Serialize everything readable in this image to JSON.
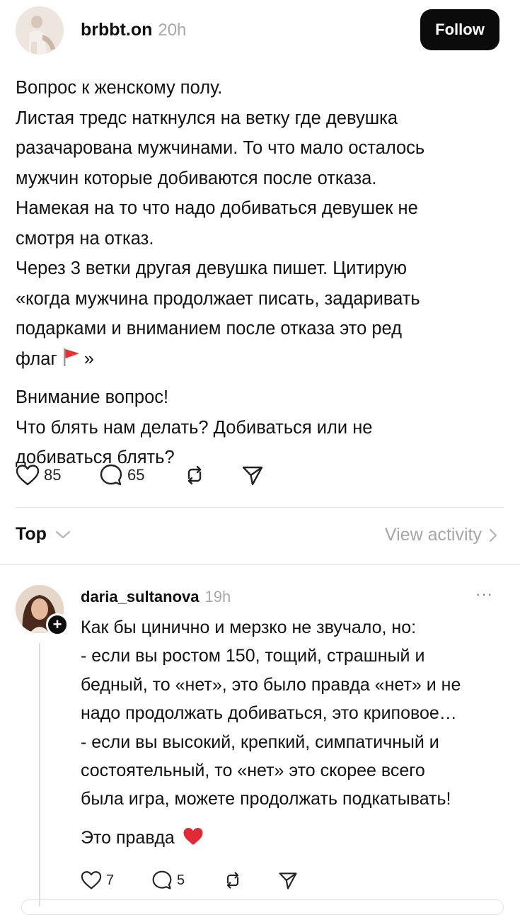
{
  "post": {
    "username": "brbbt.on",
    "time": "20h",
    "follow_label": "Follow",
    "paragraph1_lines": [
      "Вопрос к женскому полу.",
      "Листая тредс наткнулся на ветку где девушка",
      "разачарована мужчинами. То что мало осталось",
      "мужчин которые добиваются после отказа.",
      "Намекая на то что надо добиваться девушек не",
      "смотря на отказ.",
      "Через 3 ветки другая девушка пишет. Цитирую",
      "«когда мужчина продолжает писать, задаривать",
      "подарками и вниманием после отказа это ред"
    ],
    "flag_line_before": "флаг",
    "flag_line_after": "»",
    "paragraph2_lines": [
      "Внимание вопрос!",
      "Что блять нам делать? Добиваться или не",
      "добиваться блять?"
    ],
    "likes": "85",
    "comments": "65"
  },
  "sort": {
    "label": "Top",
    "view_activity": "View activity"
  },
  "reply": {
    "username": "daria_sultanova",
    "time": "19h",
    "more": "···",
    "lines": [
      "Как бы цинично и мерзко не звучало, но:",
      "- если вы ростом 150, тощий, страшный и",
      "бедный, то «нет», это было правда «нет» и не",
      "надо продолжать добиваться, это криповое…",
      "- если вы высокий, крепкий, симпатичный и",
      "состоятельный, то «нет» это скорее всего",
      "была игра, можете продолжать подкатывать!"
    ],
    "closing": "Это правда",
    "likes": "7",
    "comments": "5",
    "plus": "+"
  },
  "icons": [
    "heart-icon",
    "comment-icon",
    "repost-icon",
    "share-icon",
    "chevron-down-icon",
    "chevron-right-icon",
    "red-flag-emoji",
    "red-heart-emoji"
  ]
}
